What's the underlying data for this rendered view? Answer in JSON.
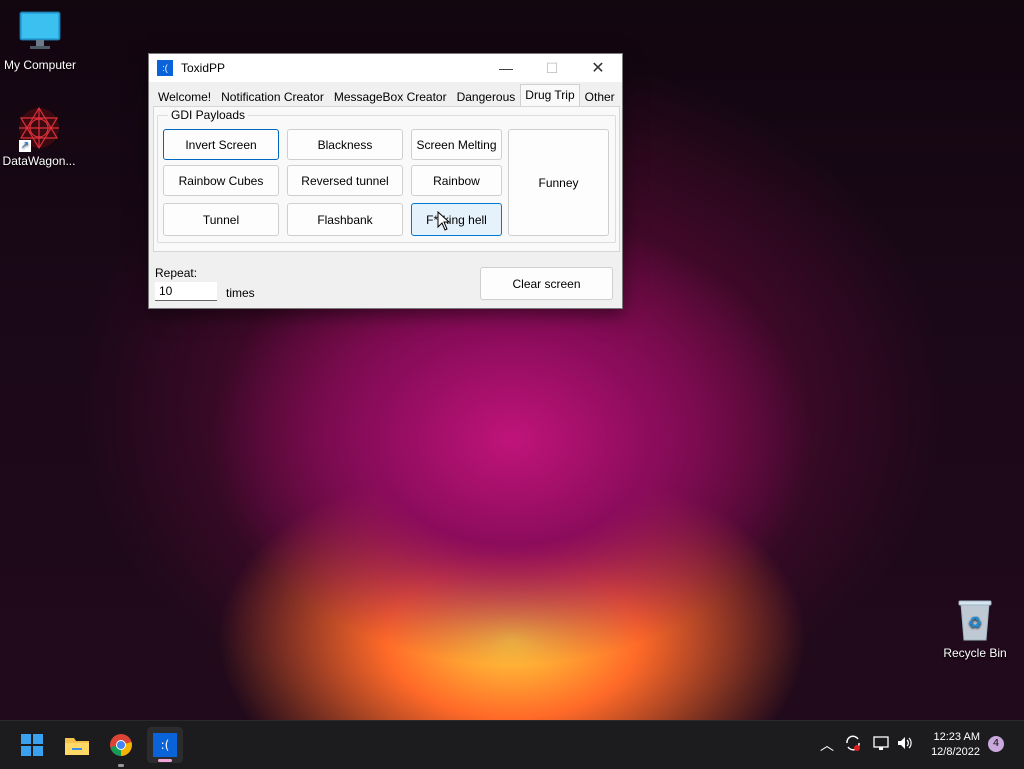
{
  "desktop": {
    "icons": [
      {
        "label": "My Computer"
      },
      {
        "label": "DataWagon..."
      },
      {
        "label": "Recycle Bin"
      }
    ]
  },
  "window": {
    "title": "ToxidPP",
    "app_icon_text": ":(",
    "controls": {
      "minimize": "—",
      "maximize": "☐",
      "close": "✕"
    },
    "tabs": [
      {
        "label": "Welcome!"
      },
      {
        "label": "Notification Creator"
      },
      {
        "label": "MessageBox Creator"
      },
      {
        "label": "Dangerous"
      },
      {
        "label": "Drug Trip"
      },
      {
        "label": "Other"
      }
    ],
    "active_tab": "Drug Trip",
    "group_label": "GDI Payloads",
    "buttons": {
      "invert_screen": "Invert Screen",
      "blackness": "Blackness",
      "screen_melting": "Screen Melting",
      "funney": "Funney",
      "rainbow_cubes": "Rainbow Cubes",
      "reversed_tunnel": "Reversed tunnel",
      "rainbow": "Rainbow",
      "tunnel": "Tunnel",
      "flashbank": "Flashbank",
      "fucking_hell": "F**king hell"
    },
    "repeat_label": "Repeat:",
    "repeat_value": "10",
    "times_label": "times",
    "clear_screen": "Clear screen"
  },
  "taskbar": {
    "apps": [
      {
        "name": "start-icon"
      },
      {
        "name": "file-explorer-icon"
      },
      {
        "name": "chrome-icon"
      },
      {
        "name": "toxidpp-icon"
      }
    ],
    "clock_time": "12:23 AM",
    "clock_date": "12/8/2022",
    "notification_count": "4"
  }
}
